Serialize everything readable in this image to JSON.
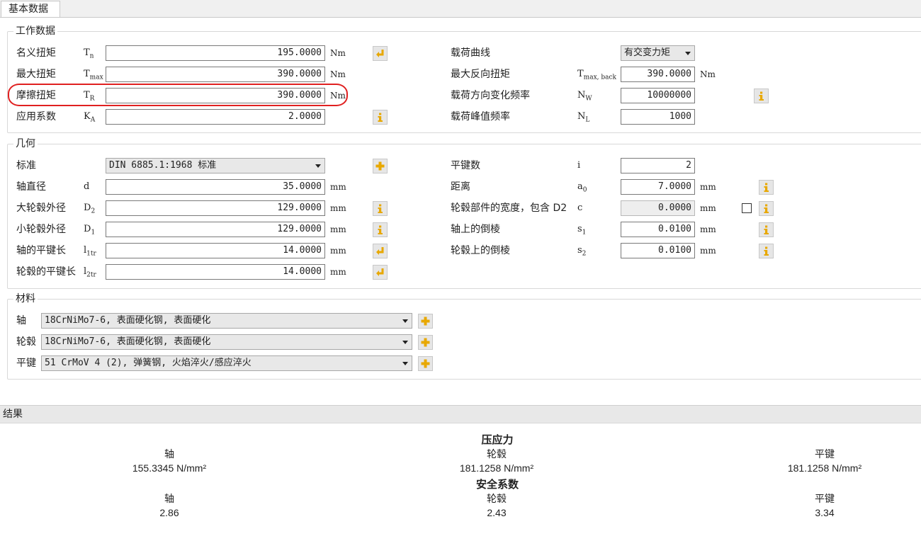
{
  "tab": {
    "label": "基本数据"
  },
  "work": {
    "title": "工作数据",
    "rows": [
      {
        "label": "名义扭矩",
        "sym": "T",
        "sub": "n",
        "value": "195.0000",
        "unit": "Nm"
      },
      {
        "label": "最大扭矩",
        "sym": "T",
        "sub": "max",
        "value": "390.0000",
        "unit": "Nm"
      },
      {
        "label": "摩擦扭矩",
        "sym": "T",
        "sub": "R",
        "value": "390.0000",
        "unit": "Nm"
      },
      {
        "label": "应用系数",
        "sym": "K",
        "sub": "A",
        "value": "2.0000",
        "unit": ""
      }
    ],
    "right": [
      {
        "label": "载荷曲线",
        "sym": "",
        "sub": "",
        "value": "有交变力矩",
        "unit": ""
      },
      {
        "label": "最大反向扭矩",
        "sym": "T",
        "sub": "max, back",
        "value": "390.0000",
        "unit": "Nm"
      },
      {
        "label": "载荷方向变化频率",
        "sym": "N",
        "sub": "W",
        "value": "10000000",
        "unit": ""
      },
      {
        "label": "载荷峰值频率",
        "sym": "N",
        "sub": "L",
        "value": "1000",
        "unit": ""
      }
    ]
  },
  "geo": {
    "title": "几何",
    "rows": [
      {
        "label": "标准",
        "sym": "",
        "sub": "",
        "value": "DIN 6885.1:1968 标准",
        "unit": ""
      },
      {
        "label": "轴直径",
        "sym": "d",
        "sub": "",
        "value": "35.0000",
        "unit": "mm"
      },
      {
        "label": "大轮毂外径",
        "sym": "D",
        "sub": "2",
        "value": "129.0000",
        "unit": "mm"
      },
      {
        "label": "小轮毂外径",
        "sym": "D",
        "sub": "1",
        "value": "129.0000",
        "unit": "mm"
      },
      {
        "label": "轴的平键长",
        "sym": "l",
        "sub": "1tr",
        "value": "14.0000",
        "unit": "mm"
      },
      {
        "label": "轮毂的平键长",
        "sym": "l",
        "sub": "2tr",
        "value": "14.0000",
        "unit": "mm"
      }
    ],
    "right": [
      {
        "label": "平键数",
        "sym": "i",
        "sub": "",
        "value": "2",
        "unit": ""
      },
      {
        "label": "距离",
        "sym": "a",
        "sub": "0",
        "value": "7.0000",
        "unit": "mm"
      },
      {
        "label": "轮毂部件的宽度，包含 D2",
        "sym": "c",
        "sub": "",
        "value": "0.0000",
        "unit": "mm"
      },
      {
        "label": "轴上的倒棱",
        "sym": "s",
        "sub": "1",
        "value": "0.0100",
        "unit": "mm"
      },
      {
        "label": "轮毂上的倒棱",
        "sym": "s",
        "sub": "2",
        "value": "0.0100",
        "unit": "mm"
      }
    ]
  },
  "mat": {
    "title": "材料",
    "rows": [
      {
        "label": "轴",
        "value": "18CrNiMo7-6, 表面硬化钢, 表面硬化"
      },
      {
        "label": "轮毂",
        "value": "18CrNiMo7-6, 表面硬化钢, 表面硬化"
      },
      {
        "label": "平键",
        "value": "51 CrMoV 4 (2), 弹簧钢, 火焰淬火/感应淬火"
      }
    ]
  },
  "results": {
    "title": "结果",
    "pressure": {
      "heading": "压应力",
      "cols": [
        {
          "label": "轴",
          "value": "155.3345 N/mm²"
        },
        {
          "label": "轮毂",
          "value": "181.1258 N/mm²"
        },
        {
          "label": "平键",
          "value": "181.1258 N/mm²"
        }
      ]
    },
    "safety": {
      "heading": "安全系数",
      "cols": [
        {
          "label": "轴",
          "value": "2.86"
        },
        {
          "label": "轮毂",
          "value": "2.43"
        },
        {
          "label": "平键",
          "value": "3.34"
        }
      ]
    }
  },
  "colors": {
    "highlight": "#e02020",
    "info_icon": "#e8a800"
  }
}
